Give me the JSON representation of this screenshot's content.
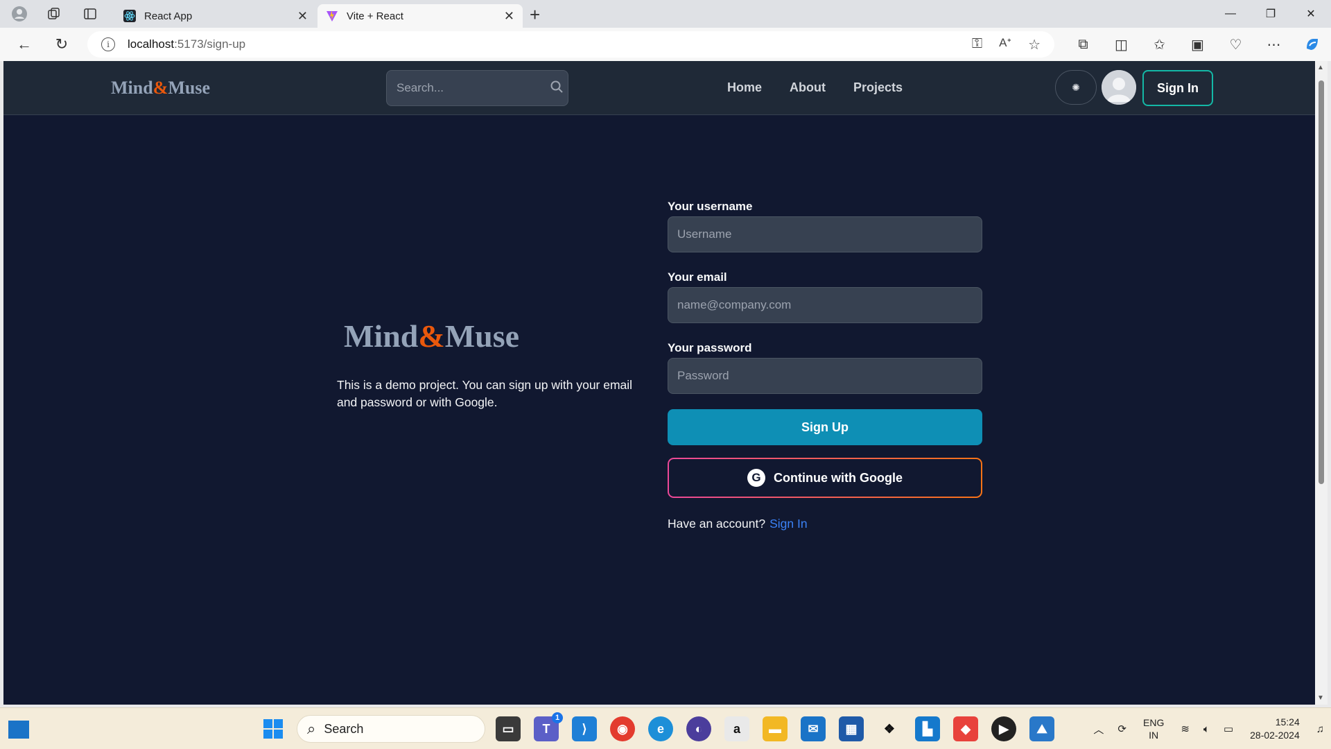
{
  "browser": {
    "tabs": [
      {
        "title": "React App",
        "active": false
      },
      {
        "title": "Vite + React",
        "active": true
      }
    ],
    "address": {
      "host": "localhost",
      "path": ":5173/sign-up"
    }
  },
  "header": {
    "logo": {
      "part1": "Mind",
      "amp": "&",
      "part2": "Muse"
    },
    "search_placeholder": "Search...",
    "nav": [
      "Home",
      "About",
      "Projects"
    ],
    "signin_label": "Sign In"
  },
  "hero": {
    "logo": {
      "part1": "Mind",
      "amp": "&",
      "part2": "Muse"
    },
    "description": "This is a demo project. You can sign up with your email and password or with Google."
  },
  "form": {
    "username_label": "Your username",
    "username_placeholder": "Username",
    "email_label": "Your email",
    "email_placeholder": "name@company.com",
    "password_label": "Your password",
    "password_placeholder": "Password",
    "submit_label": "Sign Up",
    "google_label": "Continue with Google",
    "have_account": "Have an account?",
    "signin_link": "Sign In"
  },
  "taskbar": {
    "search_label": "Search",
    "teams_badge": "1",
    "lang": {
      "line1": "ENG",
      "line2": "IN"
    },
    "time": "15:24",
    "date": "28-02-2024"
  },
  "colors": {
    "accent": "#ea580c",
    "primary_button": "#0e8fb5",
    "page_bg": "#111830",
    "header_bg": "#1f2937"
  }
}
